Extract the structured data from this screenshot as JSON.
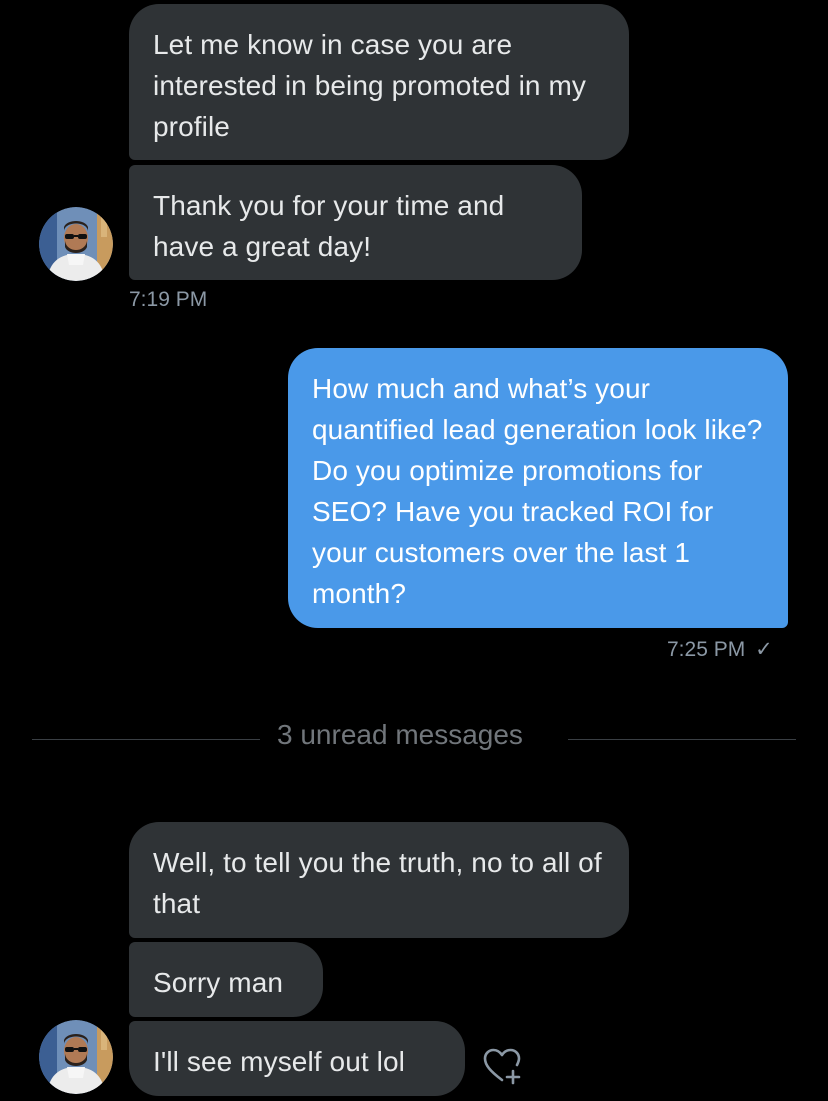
{
  "colors": {
    "background": "#000000",
    "incoming_bubble": "#2f3336",
    "outgoing_bubble": "#4a99e9",
    "timestamp": "#8b98a5",
    "divider_text": "#71767b"
  },
  "conversation": {
    "group_1": {
      "messages": [
        {
          "text": "Let me know in case you are interested in being promoted in my profile"
        },
        {
          "text": "Thank you for your time and have a great day!"
        }
      ],
      "avatar_icon": "user-avatar",
      "timestamp": "7:19 PM"
    },
    "group_2": {
      "messages": [
        {
          "text": "How much and what’s your quantified lead generation look like? Do you optimize promotions for SEO? Have you tracked ROI for your customers over the last 1 month?"
        }
      ],
      "timestamp": "7:25 PM",
      "status_icon": "check-icon",
      "status_glyph": "✓"
    },
    "divider": {
      "text": "3 unread messages"
    },
    "group_3": {
      "messages": [
        {
          "text": "Well, to tell you the truth, no to all of that"
        },
        {
          "text": "Sorry man"
        },
        {
          "text": "I'll see myself out lol"
        }
      ],
      "avatar_icon": "user-avatar",
      "reaction_icon": "add-reaction-heart-icon"
    }
  }
}
